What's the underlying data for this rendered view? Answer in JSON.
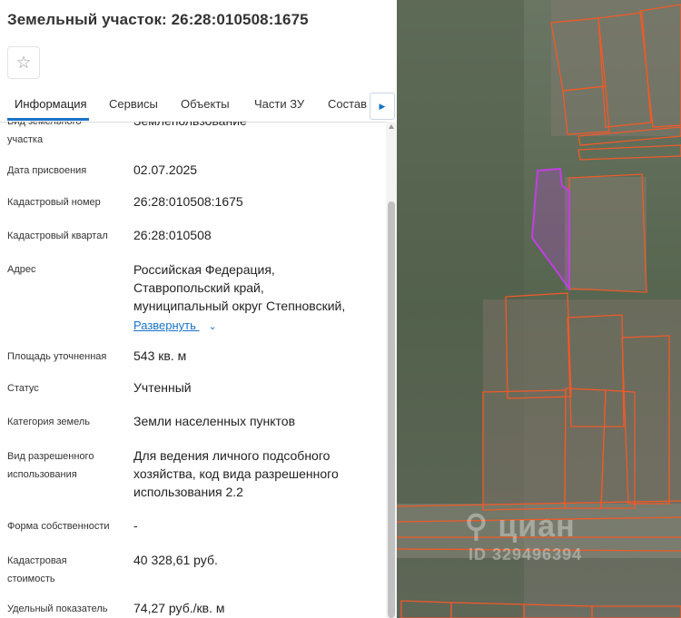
{
  "header": {
    "title": "Земельный участок: 26:28:010508:1675"
  },
  "tabs": [
    {
      "label": "Информация"
    },
    {
      "label": "Сервисы"
    },
    {
      "label": "Объекты"
    },
    {
      "label": "Части ЗУ"
    },
    {
      "label": "Состав"
    }
  ],
  "fields": {
    "land_use_type": {
      "label": "Вид земельного участка",
      "value": "Землепользование"
    },
    "date_assigned": {
      "label": "Дата присвоения",
      "value": "02.07.2025"
    },
    "cadastral_number": {
      "label": "Кадастровый номер",
      "value": "26:28:010508:1675"
    },
    "cadastral_quarter": {
      "label": "Кадастровый квартал",
      "value": "26:28:010508"
    },
    "address": {
      "label": "Адрес",
      "lines": [
        "Российская Федерация,",
        "Ставропольский край,",
        "муниципальный округ Степновский,"
      ],
      "expand_label": "Развернуть"
    },
    "area": {
      "label": "Площадь уточненная",
      "value": "543 кв. м"
    },
    "status": {
      "label": "Статус",
      "value": "Учтенный"
    },
    "land_category": {
      "label": "Категория земель",
      "value": "Земли населенных пунктов"
    },
    "permitted_use": {
      "label_lines": [
        "Вид разрешенного",
        "использования"
      ],
      "lines": [
        "Для ведения личного подсобного",
        "хозяйства, код вида разрешенного",
        "использования 2.2"
      ]
    },
    "ownership": {
      "label": "Форма собственности",
      "value": "-"
    },
    "cadastral_value": {
      "label_lines": [
        "Кадастровая",
        "стоимость"
      ],
      "value": "40 328,61 руб."
    },
    "specific_value": {
      "label": "Удельный показатель",
      "value": "74,27 руб./кв. м"
    }
  },
  "map": {
    "watermark_brand": "циан",
    "watermark_id": "ID 329496394",
    "colors": {
      "parcel_outline": "#f05a28",
      "selected_parcel": "#c040e0",
      "aerial_base": "#5a6659"
    }
  }
}
